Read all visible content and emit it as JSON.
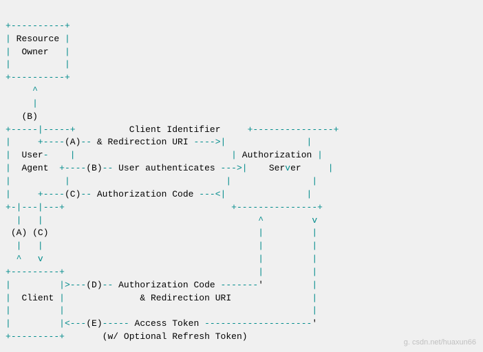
{
  "diagram": {
    "lines": [
      "+----------+",
      "| Resource |",
      "|  Owner   |",
      "|          |",
      "+----------+",
      "     ^",
      "     |",
      "   (B)",
      "+-----|-----+          Client Identifier     +---------------+",
      "|     +----(A)-- & Redirection URI ---->|               |",
      "|  User-    |                             | Authorization |",
      "|  Agent  +----(B)-- User authenticates --->|    Server     |",
      "|          |                             |               |",
      "|     +----(C)-- Authorization Code ---<|               |",
      "+-|---|---+                               +---------------+",
      "  |   |                                        ^         v",
      " (A) (C)                                       |         |",
      "  |   |                                        |         |",
      "  ^   v                                        |         |",
      "+---------+                                    |         |",
      "|         |>---(D)-- Authorization Code -------'         |",
      "|  Client |              & Redirection URI               |",
      "|         |                                              |",
      "|         |<---(E)----- Access Token --------------------'",
      "+---------+       (w/ Optional Refresh Token)"
    ],
    "watermark": "g. csdn.net/huaxun66"
  }
}
